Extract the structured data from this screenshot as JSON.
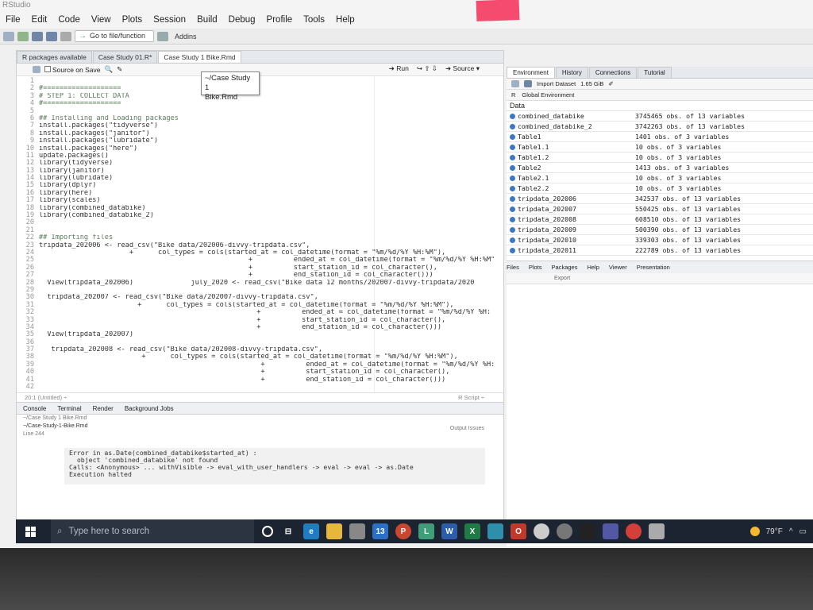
{
  "window": {
    "title": "RStudio"
  },
  "menu": [
    "File",
    "Edit",
    "Code",
    "View",
    "Plots",
    "Session",
    "Build",
    "Debug",
    "Profile",
    "Tools",
    "Help"
  ],
  "toolbar": {
    "goto_placeholder": "Go to file/function",
    "addins": "Addins"
  },
  "editor": {
    "tabs": [
      {
        "label": "R packages available"
      },
      {
        "label": "Case Study 01.R*"
      },
      {
        "label": "Case Study 1 Bike.Rmd",
        "active": true
      }
    ],
    "tooltip": {
      "line1": "~/Case Study 1",
      "line2": "Bike.Rmd"
    },
    "source_on_save": "Source on Save",
    "run_label": "Run",
    "source_label": "Source",
    "line_numbers": [
      "1",
      "2",
      "3",
      "4",
      "5",
      "6",
      "7",
      "8",
      "9",
      "10",
      "11",
      "12",
      "13",
      "14",
      "15",
      "16",
      "17",
      "18",
      "19",
      "20",
      "21",
      "22",
      "23",
      "24",
      "25",
      "26",
      "27",
      "28",
      "29",
      "30",
      "31",
      "32",
      "33",
      "34",
      "35",
      "36",
      "37",
      "38",
      "39",
      "40",
      "41",
      "42"
    ],
    "code_lines": [
      "",
      "#===================",
      "# STEP 1: COLLECT DATA",
      "#===================",
      "",
      "## Installing and Loading packages",
      "install.packages(\"tidyverse\")",
      "install.packages(\"janitor\")",
      "install.packages(\"lubridate\")",
      "install.packages(\"here\")",
      "update.packages()",
      "library(tidyverse)",
      "library(janitor)",
      "library(lubridate)",
      "library(dplyr)",
      "library(here)",
      "library(scales)",
      "library(combined_databike)",
      "library(combined_databike_2)",
      "",
      "",
      "## Importing files",
      "tripdata_202006 <- read_csv(\"Bike data/202006-divvy-tripdata.csv\",",
      "                      +      col_types = cols(started_at = col_datetime(format = \"%m/%d/%Y %H:%M\"),",
      "                                                   +          ended_at = col_datetime(format = \"%m/%d/%Y %H:%M\"",
      "                                                   +          start_station_id = col_character(),",
      "                                                   +          end_station_id = col_character()))",
      "  View(tripdata_202006)              july_2020 <- read_csv(\"Bike data 12 months/202007-divvy-tripdata/2020",
      "",
      "  tripdata_202007 <- read_csv(\"Bike data/202007-divvy-tripdata.csv\",",
      "                        +      col_types = cols(started_at = col_datetime(format = \"%m/%d/%Y %H:%M\"),",
      "                                                     +          ended_at = col_datetime(format = \"%m/%d/%Y %H:",
      "                                                     +          start_station_id = col_character(),",
      "                                                     +          end_station_id = col_character()))",
      "  View(tripdata_202007)",
      "",
      "   tripdata_202008 <- read_csv(\"Bike data/202008-divvy-tripdata.csv\",",
      "                         +      col_types = cols(started_at = col_datetime(format = \"%m/%d/%Y %H:%M\"),",
      "                                                      +          ended_at = col_datetime(format = \"%m/%d/%Y %H:",
      "                                                      +          start_station_id = col_character(),",
      "                                                      +          end_station_id = col_character()))",
      ""
    ],
    "status_left": "20:1   (Untitled) ÷",
    "status_right": "R Script ÷"
  },
  "console": {
    "tabs": [
      "Console",
      "Terminal",
      "Render",
      "Background Jobs"
    ],
    "subtitle": "~/Case Study 1 Bike.Rmd",
    "path": "~/Case-Study-1-Bike.Rmd",
    "line_label": "Line 244",
    "output_issues": "Output  Issues",
    "error_lines": [
      "Error in as.Date(combined_databike$started_at) :",
      "  object 'combined_databike' not found",
      "Calls: <Anonymous> ... withVisible -> eval_with_user_handlers -> eval -> eval -> as.Date",
      "Execution halted"
    ]
  },
  "environment": {
    "tabs": [
      "Environment",
      "History",
      "Connections",
      "Tutorial"
    ],
    "import_dataset": "Import Dataset",
    "memory": "1.65 GiB",
    "lang": "R",
    "scope": "Global Environment",
    "section": "Data",
    "rows": [
      {
        "name": "combined_databike",
        "value": "3745465 obs. of 13 variables"
      },
      {
        "name": "combined_databike_2",
        "value": "3742263 obs. of 13 variables"
      },
      {
        "name": "Table1",
        "value": "1401 obs. of 3 variables"
      },
      {
        "name": "Table1.1",
        "value": "10 obs. of 3 variables"
      },
      {
        "name": "Table1.2",
        "value": "10 obs. of 3 variables"
      },
      {
        "name": "Table2",
        "value": "1413 obs. of 3 variables"
      },
      {
        "name": "Table2.1",
        "value": "10 obs. of 3 variables"
      },
      {
        "name": "Table2.2",
        "value": "10 obs. of 3 variables"
      },
      {
        "name": "tripdata_202006",
        "value": "342537 obs. of 13 variables"
      },
      {
        "name": "tripdata_202007",
        "value": "550425 obs. of 13 variables"
      },
      {
        "name": "tripdata_202008",
        "value": "608510 obs. of 13 variables"
      },
      {
        "name": "tripdata_202009",
        "value": "500390 obs. of 13 variables"
      },
      {
        "name": "tripdata_202010",
        "value": "339303 obs. of 13 variables"
      },
      {
        "name": "tripdata_202011",
        "value": "222789 obs. of 13 variables"
      }
    ]
  },
  "files_pane": {
    "tabs": [
      "Files",
      "Plots",
      "Packages",
      "Help",
      "Viewer",
      "Presentation"
    ],
    "export": "Export"
  },
  "taskbar": {
    "search_placeholder": "Type here to search",
    "weather": "79°F",
    "mail_badge": "13"
  }
}
